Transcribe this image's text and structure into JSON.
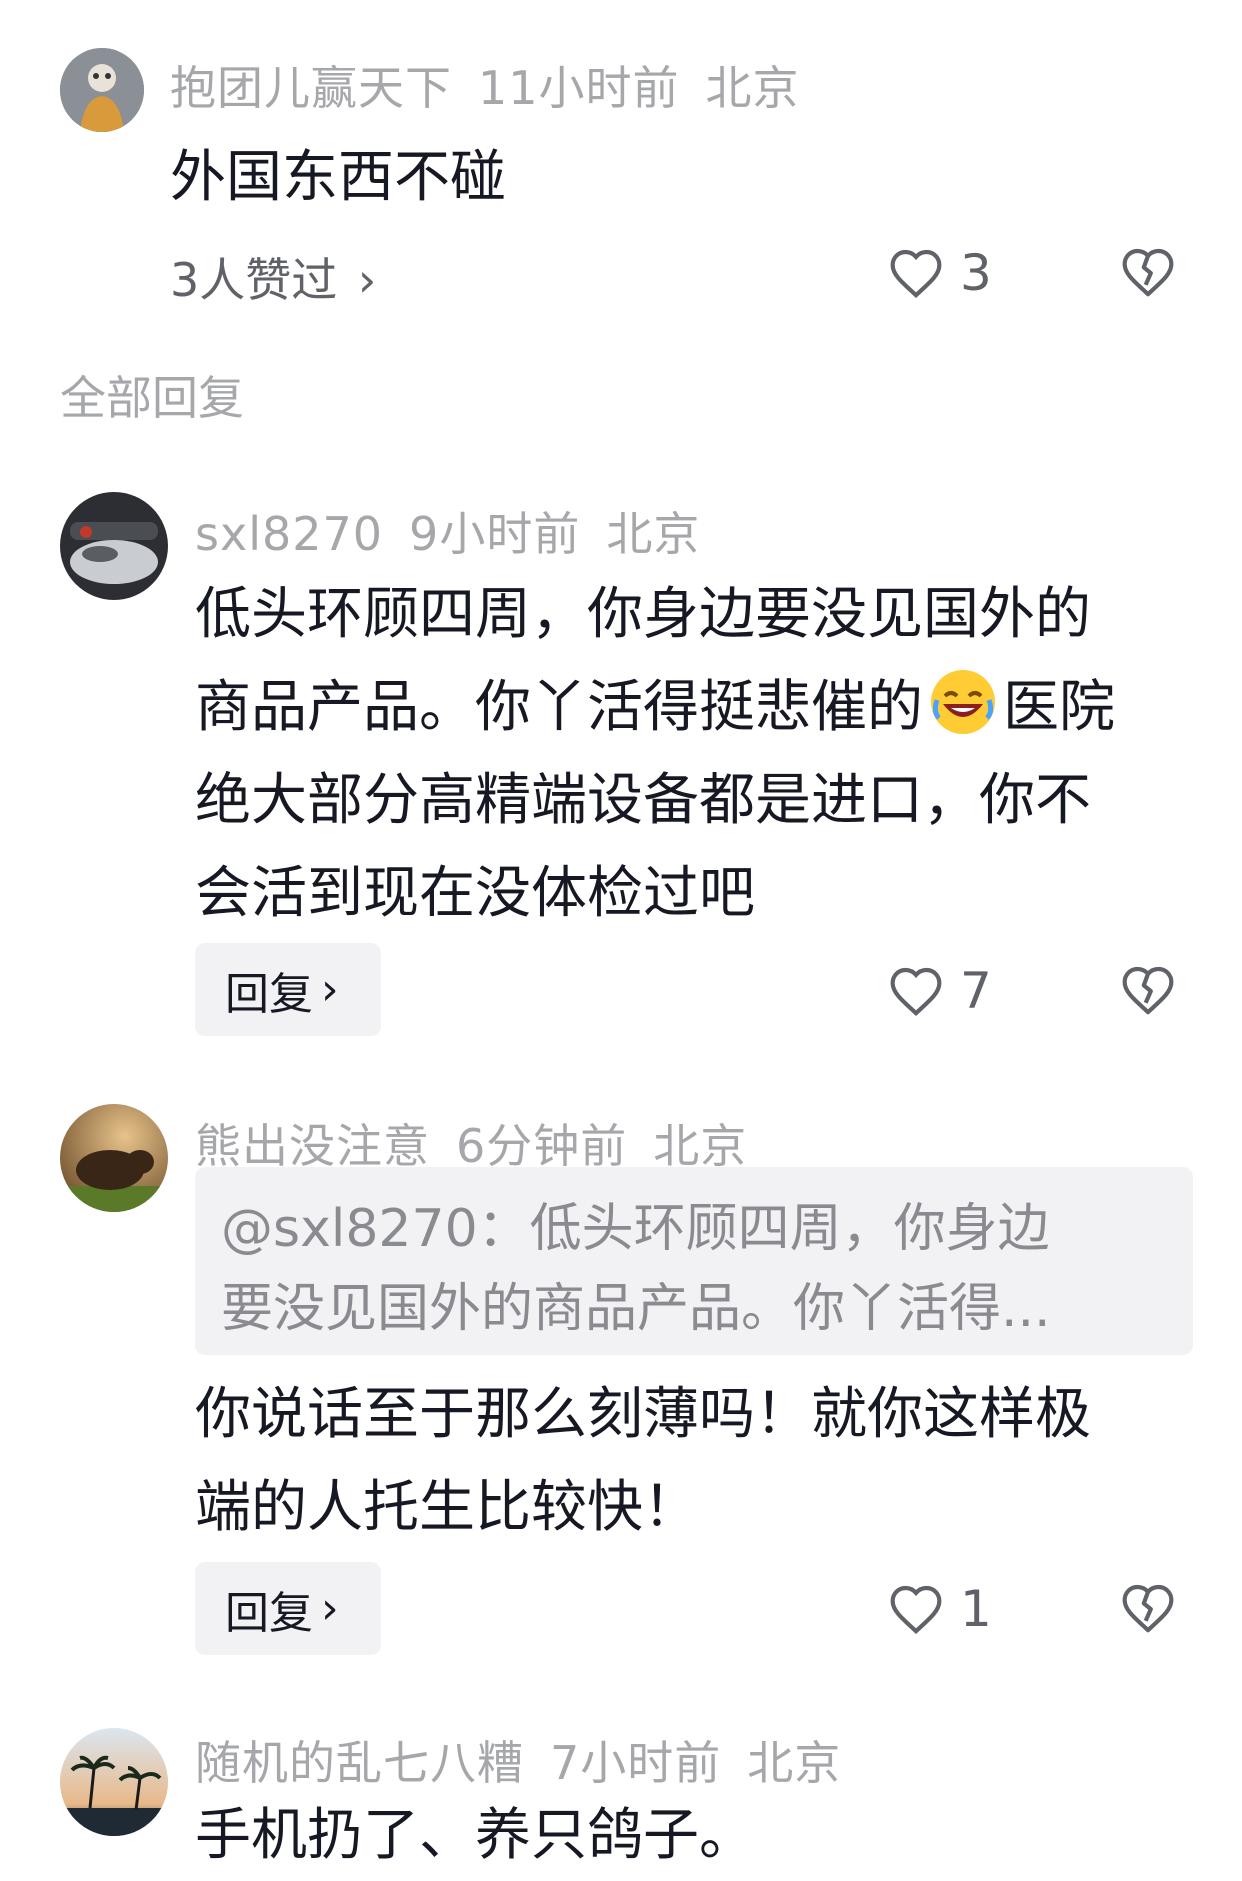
{
  "top_comment": {
    "username": "抱团儿赢天下",
    "time": "11小时前",
    "location": "北京",
    "text": "外国东西不碰",
    "liked_by": "3人赞过",
    "like_count": "3"
  },
  "section_label": "全部回复",
  "replies": [
    {
      "username": "sxl8270",
      "time": "9小时前",
      "location": "北京",
      "text_line1": "低头环顾四周，你身边要没见国外的",
      "text_line2a": "商品产品。你丫活得挺悲催的",
      "text_line2b": "医院",
      "text_line3": "绝大部分高精端设备都是进口，你不",
      "text_line4": "会活到现在没体检过吧",
      "reply_label": "回复",
      "like_count": "7",
      "emoji": "rolling-laughing-emoji"
    },
    {
      "username": "熊出没注意",
      "time": "6分钟前",
      "location": "北京",
      "quote_line1": "@sxl8270：低头环顾四周，你身边",
      "quote_line2": "要没见国外的商品产品。你丫活得...",
      "text_line1": "你说话至于那么刻薄吗！就你这样极",
      "text_line2": "端的人托生比较快！",
      "reply_label": "回复",
      "like_count": "1"
    },
    {
      "username": "随机的乱七八糟",
      "time": "7小时前",
      "location": "北京",
      "text_line1": "手机扔了、养只鸽子。"
    }
  ],
  "icons": {
    "like": "heart-outline-icon",
    "dislike": "broken-heart-icon",
    "chevron": "chevron-right-icon"
  },
  "colors": {
    "meta_text": "#a6a7ab",
    "body_text": "#161823",
    "pill_bg": "#f2f2f4"
  }
}
